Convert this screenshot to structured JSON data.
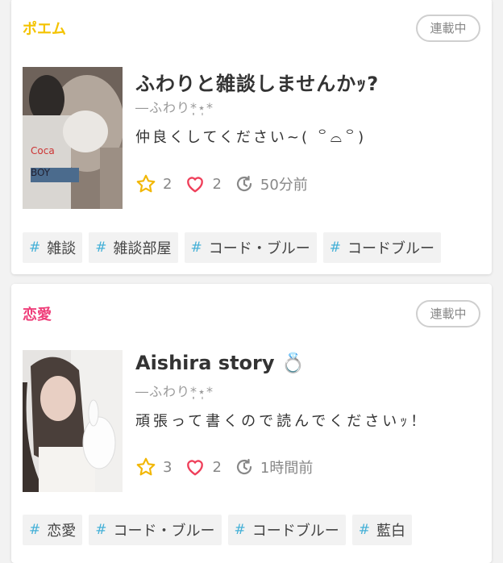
{
  "stories": [
    {
      "genre": "ポエム",
      "genre_color": "#f4c300",
      "status": "連載中",
      "title": "ふわりと雑談しませんかｯ?",
      "author": "―ふわり*̣̩⋆̩*",
      "description": "仲良くしてください~( ꒪⌓꒪)",
      "stars": "2",
      "likes": "2",
      "updated": "50分前",
      "tags": [
        "雑談",
        "雑談部屋",
        "コード・ブルー",
        "コードブルー"
      ]
    },
    {
      "genre": "恋愛",
      "genre_color": "#ef3f7a",
      "status": "連載中",
      "title": "Aishira story 💍",
      "author": "―ふわり*̣̩⋆̩*",
      "description": "頑張って書くので読んでくださいｯ！",
      "stars": "3",
      "likes": "2",
      "updated": "1時間前",
      "tags": [
        "恋愛",
        "コード・ブルー",
        "コードブルー",
        "藍白"
      ]
    }
  ],
  "colors": {
    "star": "#f2b705",
    "heart": "#ef3f5a",
    "hash": "#44b0d7"
  }
}
